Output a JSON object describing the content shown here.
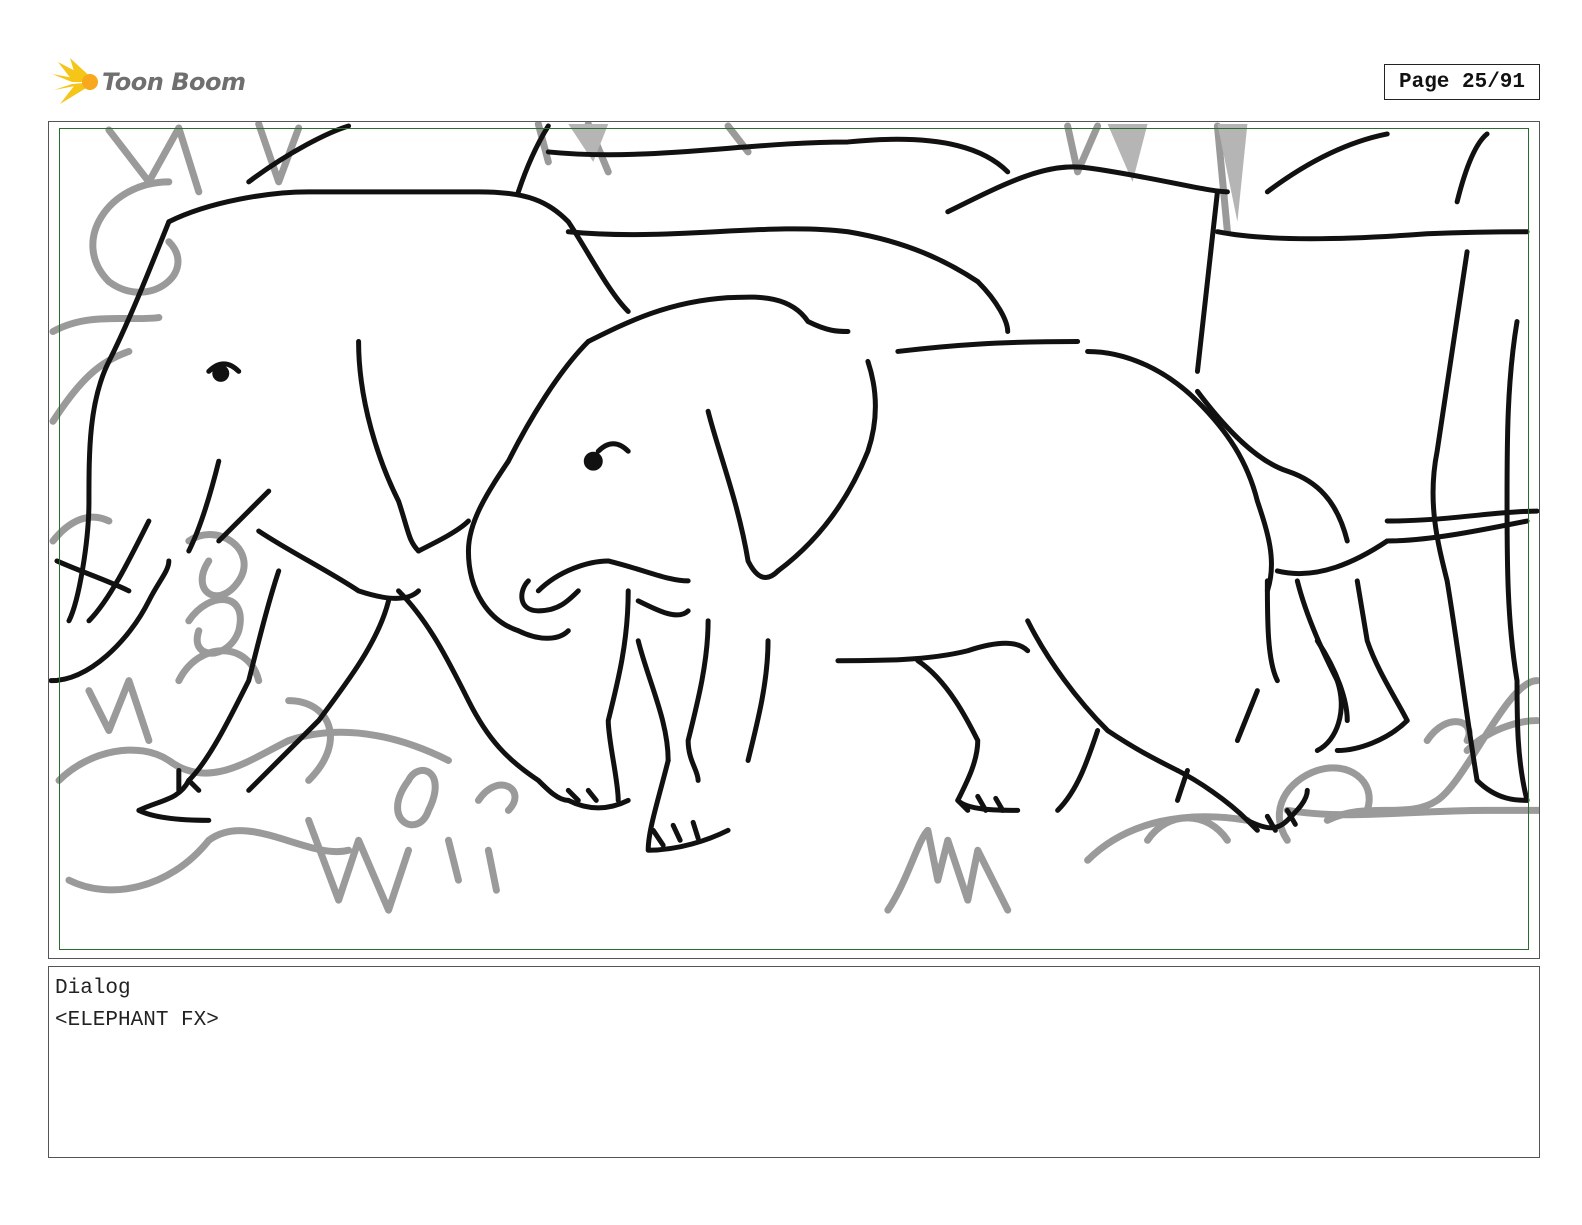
{
  "header": {
    "logo_text": "Toon Boom",
    "page_label": "Page 25/91"
  },
  "panel": {
    "drawing_icon": "elephants-sketch-icon"
  },
  "dialog": {
    "heading": "Dialog",
    "text": "<ELEPHANT FX>"
  },
  "colors": {
    "safe_frame": "#2e6b2e",
    "logo_yellow": "#f5c518",
    "sketch_line": "#111111",
    "sketch_gray": "#9a9a9a"
  }
}
